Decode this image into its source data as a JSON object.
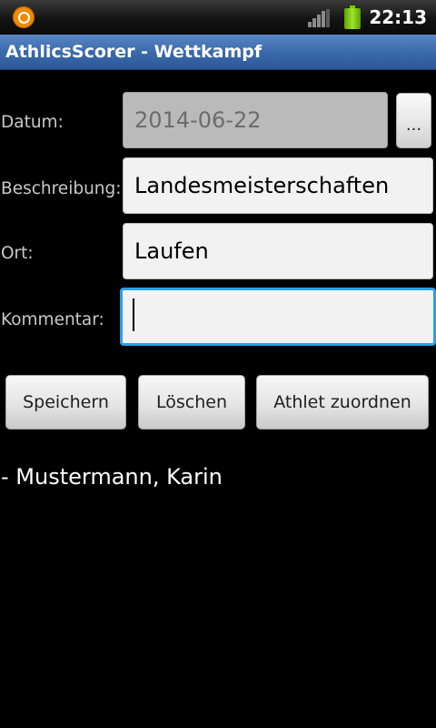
{
  "status_bar": {
    "time": "22:13",
    "icons": [
      "app-notification-icon",
      "signal-icon",
      "battery-icon"
    ],
    "battery_color": "#8fd400"
  },
  "header": {
    "title": "AthlicsScorer - Wettkampf",
    "background": "#3b6aab"
  },
  "form": {
    "date": {
      "label": "Datum:",
      "value": "2014-06-22",
      "picker_label": "..."
    },
    "description": {
      "label": "Beschreibung:",
      "value": "Landesmeisterschaften"
    },
    "location": {
      "label": "Ort:",
      "value": "Laufen"
    },
    "comment": {
      "label": "Kommentar:",
      "value": ""
    },
    "focus_color": "#2aa0e8"
  },
  "actions": {
    "save_label": "Speichern",
    "delete_label": "Löschen",
    "assign_athlete_label": "Athlet zuordnen"
  },
  "athletes": [
    "- Mustermann, Karin"
  ]
}
